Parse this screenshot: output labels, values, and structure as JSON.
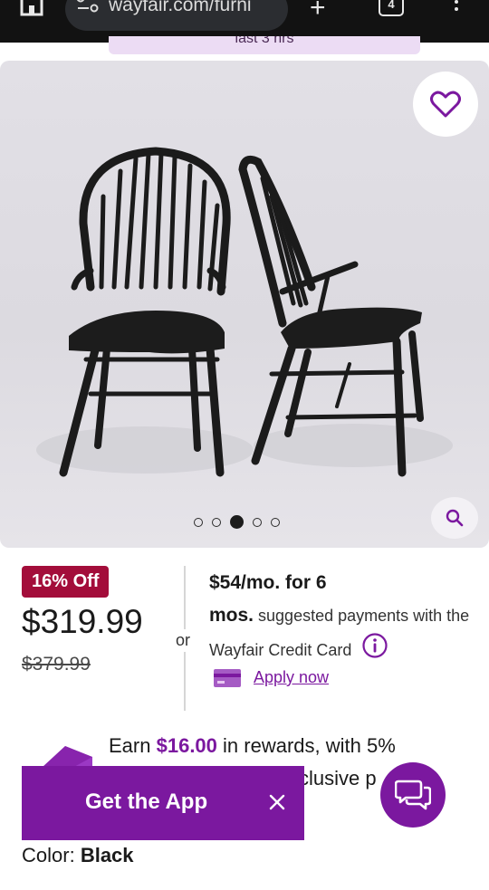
{
  "browser": {
    "url": "wayfair.com/furni",
    "tab_count": "4",
    "icons": {
      "home": "home-icon",
      "site_settings": "tune-icon",
      "new_tab": "plus-icon",
      "menu": "more-vert-icon"
    }
  },
  "urgency_banner": {
    "text": "last 3 hrs"
  },
  "gallery": {
    "total_images": 5,
    "active_index": 2,
    "favorite_icon": "heart-outline-icon",
    "zoom_icon": "search-icon"
  },
  "pricing": {
    "discount_badge": "16% Off",
    "price": "$319.99",
    "original_price": "$379.99",
    "or_label": "or",
    "monthly_bold_1": "$54/mo. for 6",
    "monthly_bold_2": "mos.",
    "monthly_text": "suggested payments with the Wayfair Credit Card",
    "apply_link": "Apply now"
  },
  "rewards": {
    "prefix": "Earn",
    "amount": "$16.00",
    "suffix_line1": "in rewards, with 5%",
    "suffix_line2": "clusive p"
  },
  "app_banner": {
    "label": "Get the App"
  },
  "color": {
    "label": "Color:",
    "value": "Black"
  },
  "colors": {
    "brand_purple": "#7b189f",
    "badge_red": "#a30d3a",
    "banner_lavender": "#ecdcf4"
  }
}
